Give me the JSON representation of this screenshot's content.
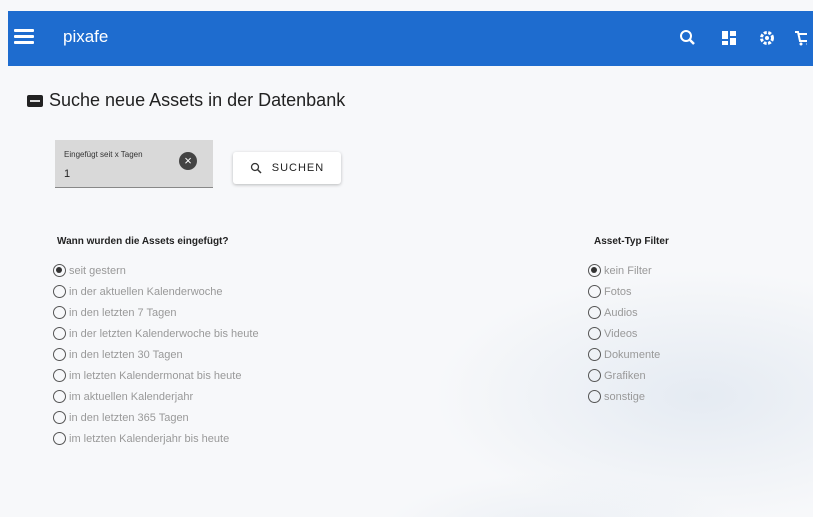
{
  "app": {
    "brand": "pixafe"
  },
  "topbar": {
    "icons": [
      "menu-icon",
      "search-icon",
      "dashboard-icon",
      "settings-icon",
      "cart-icon"
    ]
  },
  "page": {
    "title": "Suche neue Assets in der Datenbank"
  },
  "filter": {
    "days_label": "Eingefügt seit x Tagen",
    "days_value": "1",
    "search_label": "SUCHEN"
  },
  "time_group": {
    "title": "Wann wurden die Assets eingefügt?",
    "options": [
      {
        "label": "seit gestern",
        "checked": true
      },
      {
        "label": "in der aktuellen Kalenderwoche",
        "checked": false
      },
      {
        "label": "in den letzten 7 Tagen",
        "checked": false
      },
      {
        "label": "in der letzten Kalenderwoche bis heute",
        "checked": false
      },
      {
        "label": "in den letzten 30 Tagen",
        "checked": false
      },
      {
        "label": "im letzten Kalendermonat bis heute",
        "checked": false
      },
      {
        "label": "im aktuellen Kalenderjahr",
        "checked": false
      },
      {
        "label": "in den letzten 365 Tagen",
        "checked": false
      },
      {
        "label": "im letzten Kalenderjahr bis heute",
        "checked": false
      }
    ]
  },
  "type_group": {
    "title": "Asset-Typ Filter",
    "options": [
      {
        "label": "kein Filter",
        "checked": true
      },
      {
        "label": "Fotos",
        "checked": false
      },
      {
        "label": "Audios",
        "checked": false
      },
      {
        "label": "Videos",
        "checked": false
      },
      {
        "label": "Dokumente",
        "checked": false
      },
      {
        "label": "Grafiken",
        "checked": false
      },
      {
        "label": "sonstige",
        "checked": false
      }
    ]
  },
  "colors": {
    "primary": "#1e6ccf",
    "muted_text": "#999999"
  }
}
